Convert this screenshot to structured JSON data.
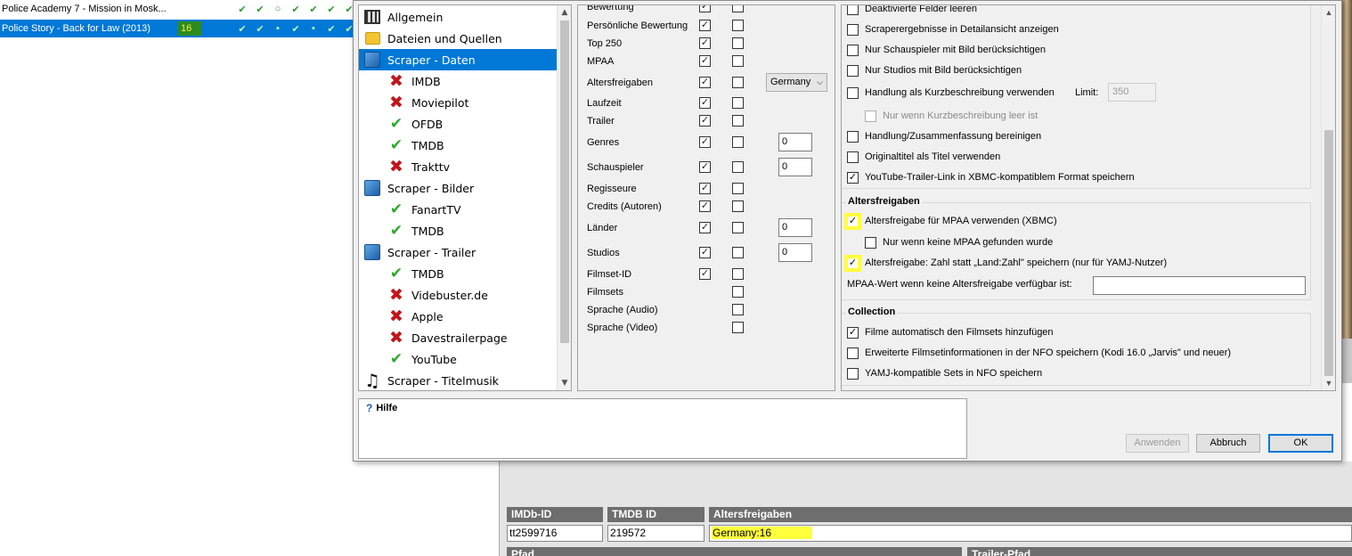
{
  "movies": [
    {
      "title": "Police Academy 7 - Mission in Mosk...",
      "rating": "",
      "marks": [
        "✔",
        "✔",
        "○",
        "✔",
        "✔",
        "✔",
        "✔"
      ]
    },
    {
      "title": "Police Story - Back for Law (2013)",
      "rating": "16",
      "marks": [
        "✔",
        "✔",
        "▪",
        "✔",
        "▪",
        "✔",
        "✔"
      ]
    }
  ],
  "tree": {
    "items": [
      {
        "label": "Allgemein",
        "icon": "film-icon"
      },
      {
        "label": "Dateien und Quellen",
        "icon": "folder-icon"
      },
      {
        "label": "Scraper - Daten",
        "icon": "scraper-icon",
        "selected": true
      },
      {
        "label": "IMDB",
        "icon": "disabled-icon",
        "child": true
      },
      {
        "label": "Moviepilot",
        "icon": "disabled-icon",
        "child": true
      },
      {
        "label": "OFDB",
        "icon": "enabled-icon",
        "child": true
      },
      {
        "label": "TMDB",
        "icon": "enabled-icon",
        "child": true
      },
      {
        "label": "Trakttv",
        "icon": "disabled-icon",
        "child": true
      },
      {
        "label": "Scraper - Bilder",
        "icon": "scraper-icon"
      },
      {
        "label": "FanartTV",
        "icon": "enabled-icon",
        "child": true
      },
      {
        "label": "TMDB",
        "icon": "enabled-icon",
        "child": true
      },
      {
        "label": "Scraper - Trailer",
        "icon": "scraper-icon"
      },
      {
        "label": "TMDB",
        "icon": "enabled-icon",
        "child": true
      },
      {
        "label": "Videbuster.de",
        "icon": "disabled-icon",
        "child": true
      },
      {
        "label": "Apple",
        "icon": "disabled-icon",
        "child": true
      },
      {
        "label": "Davestrailerpage",
        "icon": "disabled-icon",
        "child": true
      },
      {
        "label": "YouTube",
        "icon": "enabled-icon",
        "child": true
      },
      {
        "label": "Scraper - Titelmusik",
        "icon": "music-icon"
      }
    ]
  },
  "fields": [
    {
      "label": "Bewertung",
      "c1": true,
      "c2": false
    },
    {
      "label": "Persönliche Bewertung",
      "c1": true,
      "c2": false
    },
    {
      "label": "Top 250",
      "c1": true,
      "c2": false
    },
    {
      "label": "MPAA",
      "c1": true,
      "c2": false
    },
    {
      "label": "Altersfreigaben",
      "c1": true,
      "c2": false,
      "combo": "Germany"
    },
    {
      "label": "Laufzeit",
      "c1": true,
      "c2": false
    },
    {
      "label": "Trailer",
      "c1": true,
      "c2": false
    },
    {
      "label": "Genres",
      "c1": true,
      "c2": false,
      "num": "0"
    },
    {
      "label": "Schauspieler",
      "c1": true,
      "c2": false,
      "num": "0"
    },
    {
      "label": "Regisseure",
      "c1": true,
      "c2": false
    },
    {
      "label": "Credits (Autoren)",
      "c1": true,
      "c2": false
    },
    {
      "label": "Länder",
      "c1": true,
      "c2": false,
      "num": "0"
    },
    {
      "label": "Studios",
      "c1": true,
      "c2": false,
      "num": "0"
    },
    {
      "label": "Filmset-ID",
      "c1": true,
      "c2": false
    },
    {
      "label": "Filmsets",
      "c1": null,
      "c2": false
    },
    {
      "label": "Sprache (Audio)",
      "c1": null,
      "c2": false
    },
    {
      "label": "Sprache (Video)",
      "c1": null,
      "c2": false
    }
  ],
  "options": {
    "general": [
      {
        "label": "Deaktivierte Felder leeren",
        "checked": false
      },
      {
        "label": "Scraperergebnisse in Detailansicht anzeigen",
        "checked": false
      },
      {
        "label": "Nur Schauspieler mit Bild berücksichtigen",
        "checked": false
      },
      {
        "label": "Nur Studios mit Bild berücksichtigen",
        "checked": false
      },
      {
        "label": "Handlung als Kurzbeschreibung verwenden",
        "checked": false
      },
      {
        "label": "Nur wenn Kurzbeschreibung leer ist",
        "checked": false,
        "disabled": true
      },
      {
        "label": "Handlung/Zusammenfassung bereinigen",
        "checked": false
      },
      {
        "label": "Originaltitel als Titel verwenden",
        "checked": false
      },
      {
        "label": "YouTube-Trailer-Link in XBMC-kompatiblem Format speichern",
        "checked": true
      }
    ],
    "limit_label": "Limit:",
    "limit_value": "350",
    "age_group_title": "Altersfreigaben",
    "age": [
      {
        "label": "Altersfreigabe für MPAA verwenden (XBMC)",
        "checked": true
      },
      {
        "label": "Nur wenn keine MPAA gefunden wurde",
        "checked": false
      },
      {
        "label": "Altersfreigabe: Zahl statt „Land:Zahl\" speichern (nur für YAMJ-Nutzer)",
        "checked": true
      }
    ],
    "mpaa_fallback_label": "MPAA-Wert wenn keine Altersfreigabe verfügbar ist:",
    "collection_group_title": "Collection",
    "collection": [
      {
        "label": "Filme automatisch den Filmsets hinzufügen",
        "checked": true
      },
      {
        "label": "Erweiterte Filmsetinformationen in der NFO speichern (Kodi 16.0 „Jarvis\" und neuer)",
        "checked": false
      },
      {
        "label": "YAMJ-kompatible Sets in NFO speichern",
        "checked": false
      }
    ]
  },
  "help": {
    "title": "Hilfe"
  },
  "buttons": {
    "apply": "Anwenden",
    "cancel": "Abbruch",
    "ok": "OK"
  },
  "details": {
    "imdb_header": "IMDb-ID",
    "imdb_value": "tt2599716",
    "tmdb_header": "TMDB ID",
    "tmdb_value": "219572",
    "cert_header": "Altersfreigaben",
    "cert_value": "Germany:16",
    "path_header": "Pfad",
    "trailer_path_header": "Trailer-Pfad"
  },
  "colors": {
    "selection": "#0078d7",
    "highlight": "#ffff3c",
    "ok_green": "#2fa82f",
    "error_red": "#c0161c"
  }
}
